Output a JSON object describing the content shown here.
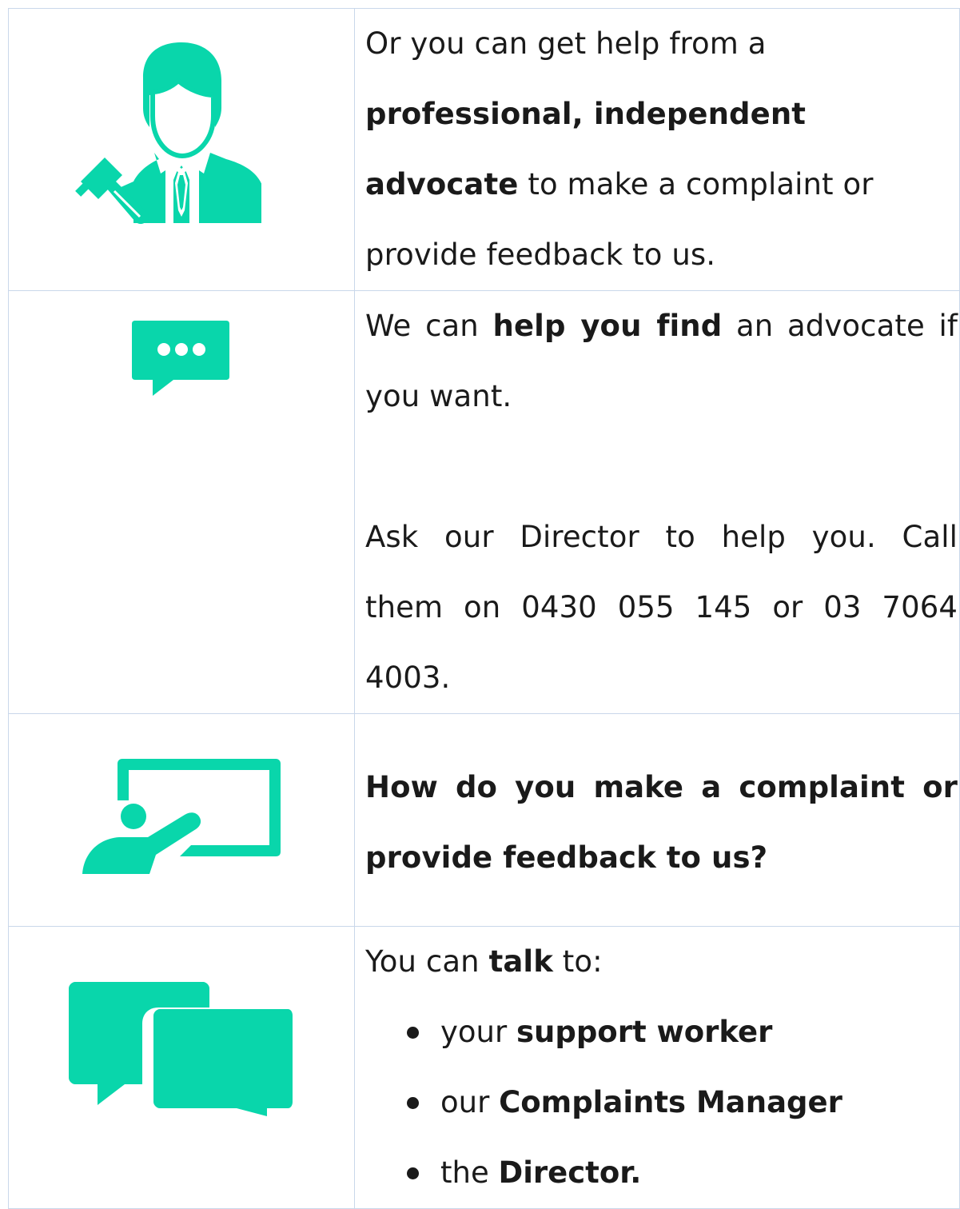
{
  "colors": {
    "icon": "#09d6ab",
    "border": "#c9d7ea",
    "text": "#1a1a1a"
  },
  "rows": [
    {
      "icon": "advocate-with-gavel-icon",
      "lines": [
        {
          "plain_before": "Or you can get help from a"
        },
        {
          "bold": "professional, independent"
        },
        {
          "bold": "advocate",
          "plain_after": " to make a complaint or"
        },
        {
          "plain_before": "provide feedback to us."
        }
      ]
    },
    {
      "icon": "speech-bubble-dots-icon",
      "lines": [
        {
          "plain_before": "We can ",
          "bold": "help you find",
          "plain_after": " an advocate if"
        },
        {
          "plain_before": "you want."
        },
        {
          "plain_before": "Ask our Director to help you. Call"
        },
        {
          "plain_before": "them on 0430 055 145 or 03 7064"
        },
        {
          "plain_before": "4003."
        }
      ]
    },
    {
      "icon": "presenter-board-icon",
      "heading_lines": [
        "How do you make a complaint or",
        "provide feedback to us?"
      ]
    },
    {
      "icon": "conversation-bubbles-icon",
      "intro": {
        "plain_before": "You can ",
        "bold": "talk",
        "plain_after": " to:"
      },
      "bullets": [
        {
          "plain_before": "your ",
          "bold": "support worker",
          "plain_after": ""
        },
        {
          "plain_before": "our ",
          "bold": "Complaints Manager",
          "plain_after": ""
        },
        {
          "plain_before": "the ",
          "bold": "Director.",
          "plain_after": ""
        }
      ]
    }
  ]
}
